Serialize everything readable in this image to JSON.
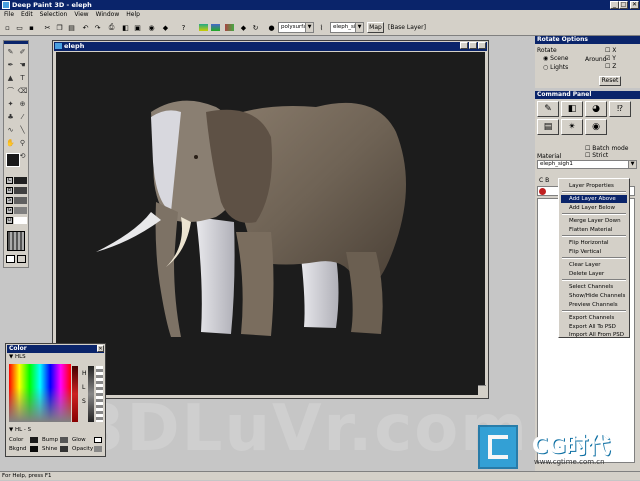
{
  "window": {
    "title": "Deep Paint 3D - eleph",
    "min": "_",
    "max": "□",
    "close": "✕"
  },
  "menubar": [
    "File",
    "Edit",
    "Selection",
    "View",
    "Window",
    "Help"
  ],
  "toolbar": {
    "object_select": "polysurfac",
    "texture_select": "eleph_sigh",
    "map_button": "Map",
    "layer_label": "[Base Layer]"
  },
  "document": {
    "title": "eleph"
  },
  "watermark": "3DLuVr.com",
  "color_panel": {
    "title": "Color",
    "mode": "HLS",
    "h_label": "H",
    "l_label": "L",
    "s_label": "S",
    "mode2": "HL - S",
    "row1": [
      "Color",
      "Bump",
      "Glow"
    ],
    "row2": [
      "Bkgnd",
      "Shine",
      "Opacity"
    ],
    "colors": {
      "primary": "#1a1a1a",
      "selected_hue": "#c02020"
    }
  },
  "rotate_options": {
    "title": "Rotate Options",
    "rotate_label": "Rotate",
    "scene_label": "Scene",
    "lights_label": "Lights",
    "around_label": "Around",
    "axes": [
      {
        "label": "X",
        "checked": false
      },
      {
        "label": "Y",
        "checked": true
      },
      {
        "label": "Z",
        "checked": false
      }
    ],
    "reset_label": "Reset"
  },
  "command_panel": {
    "title": "Command Panel",
    "batch_mode": "Batch mode",
    "strict": "Strict",
    "material_label": "Material",
    "material_value": "eleph_sigh1",
    "channels": "C  B"
  },
  "context_menu": {
    "items": [
      "Layer Properties",
      "Add Layer Above",
      "Add Layer Below",
      "Merge Layer Down",
      "Flatten Material",
      "Flip Horizontal",
      "Flip Vertical",
      "Clear Layer",
      "Delete Layer",
      "Select Channels",
      "Show/Hide Channels",
      "Preview Channels",
      "Export Channels",
      "Export All To PSD",
      "Import All From PSD"
    ],
    "selected": "Add Layer Above"
  },
  "logo": {
    "text": "CG时代",
    "url": "www.cgtime.com.cn"
  },
  "status": "For Help, press F1"
}
